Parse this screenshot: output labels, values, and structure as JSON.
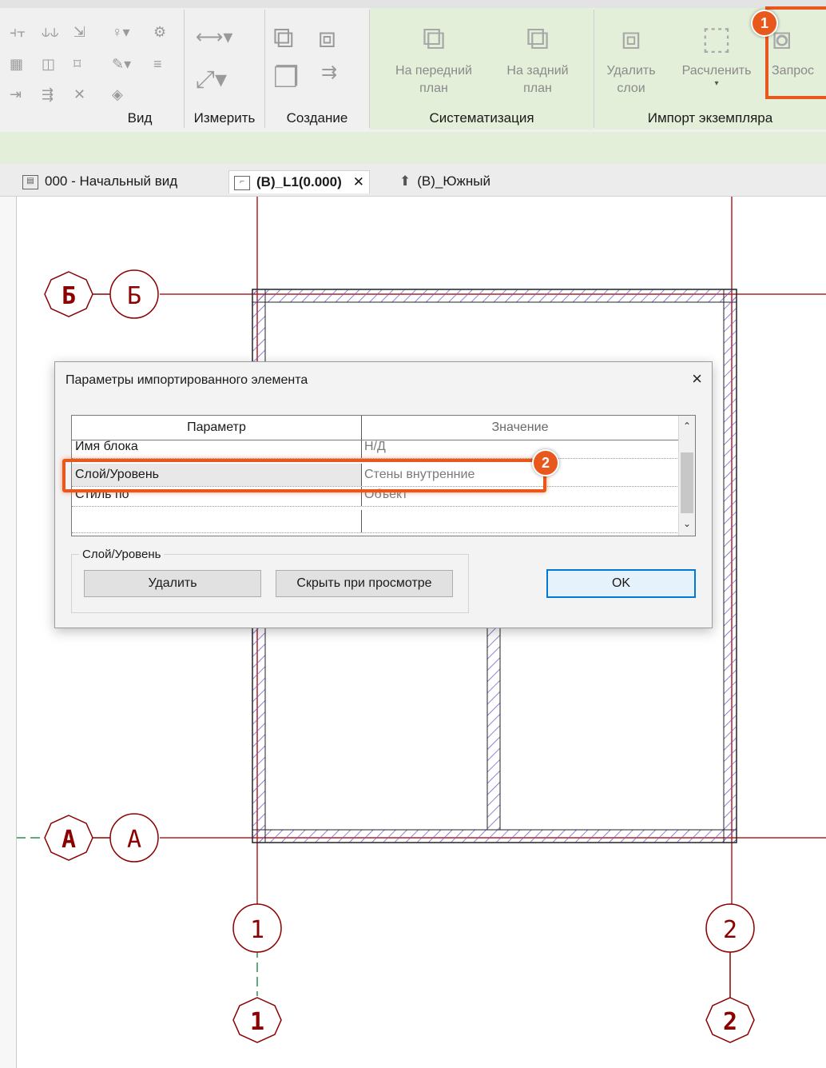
{
  "ribbon": {
    "panels": {
      "view_label": "Вид",
      "measure_label": "Измерить",
      "create_label": "Создание",
      "arrange_label": "Систематизация",
      "import_label": "Импорт экземпляра"
    },
    "buttons": {
      "front_line1": "На передний",
      "front_line2": "план",
      "back_line1": "На задний",
      "back_line2": "план",
      "delete_layers_line1": "Удалить",
      "delete_layers_line2": "слои",
      "explode": "Расчленить",
      "query": "Запрос"
    }
  },
  "tabs": [
    {
      "label": "000 - Начальный вид"
    },
    {
      "label": "(В)_L1(0.000)"
    },
    {
      "label": "(В)_Южный"
    }
  ],
  "grid_bubbles": {
    "b_top_left": "Б",
    "b_top_right": "Б",
    "a_left": "А",
    "a_right": "А",
    "one_top": "1",
    "one_bottom": "1",
    "two_top": "2",
    "two_bottom": "2"
  },
  "dialog": {
    "title": "Параметры импортированного элемента",
    "close_icon": "×",
    "header_param": "Параметр",
    "header_value": "Значение",
    "rows": [
      {
        "param": "Имя блока",
        "value": "Н/Д"
      },
      {
        "param": "Слой/Уровень",
        "value": "Стены внутренние"
      },
      {
        "param": "Стиль по",
        "value": "Объект"
      },
      {
        "param": "",
        "value": ""
      }
    ],
    "group_label": "Слой/Уровень",
    "delete_button": "Удалить",
    "hide_button": "Скрыть при просмотре",
    "ok_button": "OK"
  },
  "callouts": {
    "badge1": "1",
    "badge2": "2"
  },
  "colors": {
    "highlight": "#e8581c",
    "grid_line": "#b22222",
    "green_panel": "#e4efd9"
  }
}
